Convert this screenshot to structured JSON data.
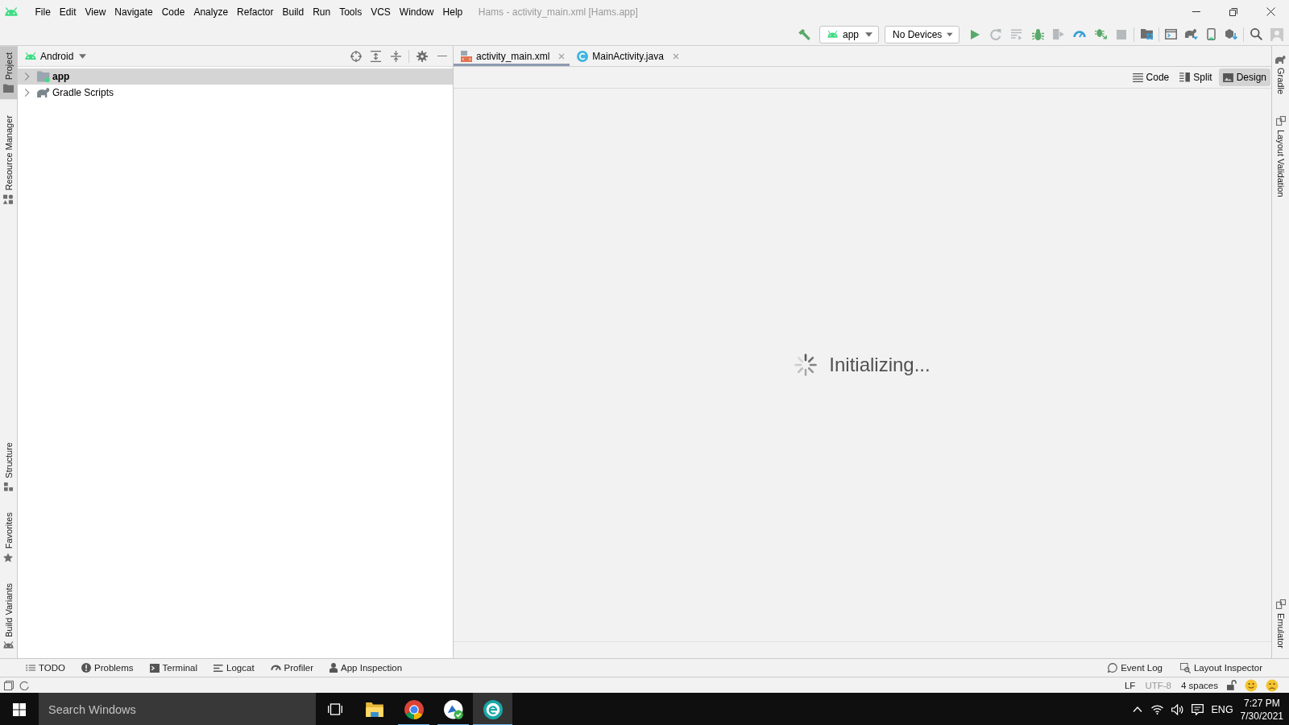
{
  "menu_bar": {
    "items": [
      "File",
      "Edit",
      "View",
      "Navigate",
      "Code",
      "Analyze",
      "Refactor",
      "Build",
      "Run",
      "Tools",
      "VCS",
      "Window",
      "Help"
    ],
    "title": "Hams - activity_main.xml [Hams.app]"
  },
  "toolbar": {
    "run_configuration": "app",
    "device": "No Devices",
    "actions": [
      {
        "disabled": false
      },
      {
        "disabled": true
      },
      {
        "disabled": true
      },
      {
        "disabled": false
      },
      {
        "disabled": true
      },
      {
        "disabled": false
      },
      {
        "disabled": false
      },
      {
        "disabled": true
      }
    ]
  },
  "left_strip": {
    "top": [
      {
        "label": "Project",
        "selected": true
      },
      {
        "label": "Resource Manager",
        "selected": false
      }
    ],
    "bottom": [
      {
        "label": "Structure",
        "selected": false
      },
      {
        "label": "Favorites",
        "selected": false
      },
      {
        "label": "Build Variants",
        "selected": false
      }
    ]
  },
  "project_panel": {
    "view": "Android",
    "tree": [
      {
        "label": "app",
        "kind": "module",
        "expanded": false,
        "selected": true
      },
      {
        "label": "Gradle Scripts",
        "kind": "gradle",
        "expanded": false,
        "selected": false
      }
    ]
  },
  "editor": {
    "tabs": [
      {
        "label": "activity_main.xml",
        "kind": "layout",
        "selected": true
      },
      {
        "label": "MainActivity.java",
        "kind": "class",
        "selected": false
      }
    ],
    "view_modes": [
      {
        "label": "Code",
        "selected": false
      },
      {
        "label": "Split",
        "selected": false
      },
      {
        "label": "Design",
        "selected": true
      }
    ],
    "message": "Initializing..."
  },
  "right_strip": {
    "top": [
      {
        "label": "Gradle"
      },
      {
        "label": "Layout Validation"
      }
    ],
    "bottom": [
      {
        "label": "Emulator"
      }
    ]
  },
  "tool_windows": {
    "left": [
      "TODO",
      "Problems",
      "Terminal",
      "Logcat",
      "Profiler",
      "App Inspection"
    ],
    "right": [
      "Event Log",
      "Layout Inspector"
    ]
  },
  "status_bar": {
    "items": [
      {
        "label": "LF",
        "dimmed": false
      },
      {
        "label": "UTF-8",
        "dimmed": true
      },
      {
        "label": "4 spaces",
        "dimmed": false
      }
    ]
  },
  "taskbar": {
    "search": {
      "placeholder": "Search Windows"
    },
    "apps": [
      {
        "running": false,
        "selected": false
      },
      {
        "running": true,
        "selected": false
      },
      {
        "running": true,
        "selected": false
      },
      {
        "running": true,
        "selected": true
      }
    ],
    "language": "ENG",
    "time": "7:27 PM",
    "date": "7/30/2021"
  }
}
